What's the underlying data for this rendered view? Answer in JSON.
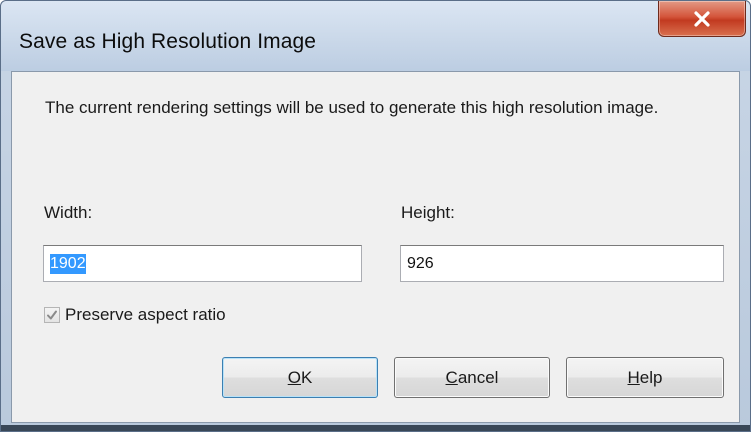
{
  "window": {
    "title": "Save as High Resolution Image"
  },
  "icons": {
    "close": "close-icon",
    "check": "checkmark-icon"
  },
  "dialog": {
    "message": "The current rendering settings will be used to generate this high resolution image.",
    "width": {
      "label": "Width:",
      "value": "1902",
      "selected": true
    },
    "height": {
      "label": "Height:",
      "value": "926"
    },
    "preserve_aspect_ratio": {
      "label": "Preserve aspect ratio",
      "checked": true,
      "enabled": false
    },
    "buttons": {
      "ok": {
        "mnemonic": "O",
        "rest": "K"
      },
      "cancel": {
        "mnemonic": "C",
        "rest": "ancel"
      },
      "help": {
        "mnemonic": "H",
        "rest": "elp"
      }
    }
  },
  "colors": {
    "close_button": "#c7432a",
    "selection": "#3399ff",
    "dialog_background": "#f0f0f0"
  }
}
